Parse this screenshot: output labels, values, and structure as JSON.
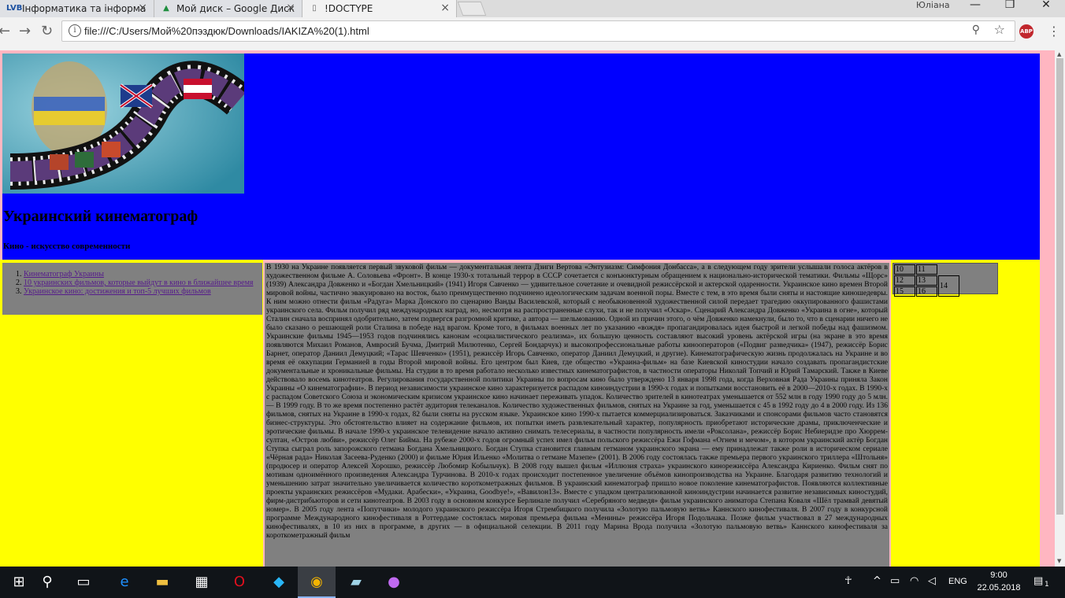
{
  "browser": {
    "tabs": [
      {
        "label": "Інформатика та інформа",
        "icon": "lvb-icon",
        "active": false
      },
      {
        "label": "Мой диск – Google Диск",
        "icon": "google-drive-icon",
        "active": false
      },
      {
        "label": "!DOCTYPE",
        "icon": "page-icon",
        "active": true
      }
    ],
    "user": "Юліана",
    "url": "file:///C:/Users/Мой%20пэздюк/Downloads/IAKIZA%20(1).html"
  },
  "page": {
    "title": "Украинский кинематограф",
    "subtitle": "Кино - искусство современности",
    "nav": [
      "Кинематограф Украины",
      "10 украинских фильмов, которые выйдут в кино в ближайшее время",
      "Украинское кино: достижения и топ-5 лучших фильмов"
    ],
    "article": "В 1930 на Украине появляется первый звуковой фильм — документальная лента Дзиги Вертова «Энтузиазм: Симфония Донбасса», а в следующем году зрители услышали голоса актёров в художественном фильме А. Соловьева «Фронт». В конце 1930-х тотальный террор в СССР сочетается с конъюнктурным обращением к национально-исторической тематики. Фильмы «Щорс» (1939) Александра Довженко и «Богдан Хмельницкий» (1941) Игоря Савченко — удивительное сочетание и очевидной режиссёрской и актерской одаренности. Украинское кино времен Второй мировой войны, частично эвакуировано на восток, было преимущественно подчинено идеологическим задачам военной поры. Вместе с тем, в это время были сняты и настоящие киношедевры. К ним можно отнести фильм «Радуга» Марка Донского по сценарию Ванды Василевской, который с необыкновенной художественной силой передает трагедию оккупированного фашистами украинского села. Фильм получил ряд международных наград, но, несмотря на распространенные слухи, так и не получил «Оскар». Сценарий Александра Довженко «Украина в огне», который Сталин сначала воспринял одобрительно, затем подвергся разгромной критике, а автора — шельмованию. Одной из причин этого, о чём Довженко намекнули, было то, что в сценарии ничего не было сказано о решающей роли Сталина в победе над врагом. Кроме того, в фильмах военных лет по указанию «вождя» пропагандировалась идея быстрой и легкой победы над фашизмом. Украинские фильмы 1945—1953 годов подчинялись канонам «социалистического реализма», их большую ценность составляют высокий уровень актёрской игры (на экране в это время появляются Михаил Романов, Амвросий Бучма, Дмитрий Милютенко, Сергей Бондарчук) и высокопрофессиональные работы кинооператоров («Подвиг разведчика» (1947), режиссёр Борис Барнет, оператор Даниил Демуцкий; «Тарас Шевченко» (1951), режиссёр Игорь Савченко, оператор Даниил Демуцкий, и другие). Кинематографическую жизнь продолжалась на Украине и во время её оккупации Германией в годы Второй мировой войны. Его центром был Киев, где общество «Украина-фильм» на базе Киевской киностудии начало создавать пропагандистские документальные и хроникальные фильмы. На студии в то время работало несколько известных кинематографистов, в частности операторы Николай Топчий и Юрий Тамарский. Также в Киеве действовало восемь кинотеатров. Регулирования государственной политики Украины по вопросам кино было утверждено 13 января 1998 года, когда Верховная Рада Украины приняла Закон Украины «О кинематографии». В период независимости украинское кино характеризуется распадом киноиндустрии в 1990-х годах и попытками восстановить её в 2000—2010-х годах. В 1990-х с распадом Советского Союза и экономическим кризисом украинское кино начинает переживать упадок. Количество зрителей в кинотеатрах уменьшается от 552 млн в году 1990 году до 5 млн. — В 1999 году. В то же время постепенно растёт аудитория телеканалов. Количество художественных фильмов, снятых на Украине за год, уменьшается с 45 в 1992 году до 4 в 2000 году. Из 136 фильмов, снятых на Украине в 1990-х годах, 82 были сняты на русском языке. Украинское кино 1990-х пытается коммерциализироваться. Заказчиками и спонсорами фильмов часто становятся бизнес-структуры. Это обстоятельство влияет на содержание фильмов, их попытки иметь развлекательный характер, популярность приобретают исторические драмы, приключенческие и эротические фильмы. В начале 1990-х украинское телевидение начало активно снимать телесериалы, в частности популярность имели «Роксолана», режиссёр Борис Небиеридзе про Хюррем-султан, «Остров любви», режиссёр Олег Бийма. На рубеже 2000-х годов огромный успех имел фильм польского режиссёра Ежи Гофмана «Огнем и мечом», в котором украинский актёр Богдан Ступка сыграл роль запорожского гетмана Богдана Хмельницкого. Богдан Ступка становится главным гетманом украинского экрана — ему принадлежат также роли в историческом сериале «Чёрная рада» Николая Засеева-Руденко (2000) и фильме Юрия Ильенко «Молитва о гетмане Мазепе» (2001). В 2006 году состоялась также премьера первого украинского триллера «Штольня» (продюсер и оператор Алексей Хорошко, режиссёр Любомир Кобыльчук). В 2008 году вышел фильм «Иллюзия страха» украинского кинорежиссёра Александра Кириенко. Фильм снят по мотивам одноимённого произведения Александра Турчинова. В 2010-х годах происходит постепенное увеличение объёмов кинопроизводства на Украине. Благодаря развитию технологий и уменьшению затрат значительно увеличивается количество короткометражных фильмов. В украинский кинематограф пришло новое поколение кинематографистов. Появляются коллективные проекты украинских режиссёров «Мудаки. Арабески», «Украина, Goodbye!», «Вавилон13». Вместе с упадком централизованной киноиндустрии начинается развитие независимых киностудий, фирм-дистрибьюторов и сети кинотеатров. В 2003 году в основном конкурсе Берлинале получил «Серебряного медведя» фильм украинского аниматора Степана Коваля «Шёл трамвай девятый номер». В 2005 году лента «Попутчики» молодого украинского режиссёра Игоря Стрембицкого получила «Золотую пальмовую ветвь» Каннского кинофестиваля. В 2007 году в конкурсной программе Международного кинофестиваля в Роттердаме состоялась мировая премьера фильма «Менины» режиссёра Игоря Подольчака. Позже фильм участвовал в 27 международных кинофестивалях, в 10 из них в программе, в других — в официальной селекции. В 2011 году Марина Врода получила «Золотую пальмовую ветвь» Каннского кинофестиваля за короткометражный фильм",
    "grid": {
      "r1": [
        "10",
        "11"
      ],
      "r2": [
        "12",
        "13",
        "14"
      ],
      "r3": [
        "15",
        "16"
      ]
    },
    "colors": {
      "header_bg": "#0000ff",
      "side_bg": "#ffff00",
      "box_bg": "#808080",
      "border": "#ffb6c1"
    }
  },
  "taskbar": {
    "lang": "ENG",
    "time": "9:00",
    "date": "22.05.2018",
    "notifications": "1"
  }
}
